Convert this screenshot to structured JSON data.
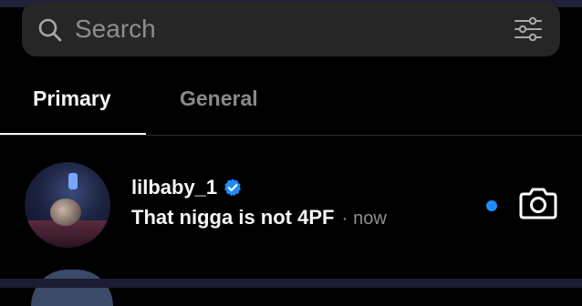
{
  "search": {
    "placeholder": "Search",
    "search_icon": "search-icon",
    "filter_icon": "filter-sliders-icon"
  },
  "tabs": [
    {
      "label": "Primary",
      "active": true
    },
    {
      "label": "General",
      "active": false
    }
  ],
  "threads": [
    {
      "name": "lilbaby_1",
      "verified": true,
      "message": "That nigga is not 4PF",
      "separator": "·",
      "time": "now",
      "unread": true,
      "action_icon": "camera-icon"
    }
  ],
  "colors": {
    "background": "#000000",
    "search_bg": "#262626",
    "muted_text": "#8e8e8e",
    "unread_dot": "#1f8cff",
    "verified_badge": "#1f8cff"
  }
}
